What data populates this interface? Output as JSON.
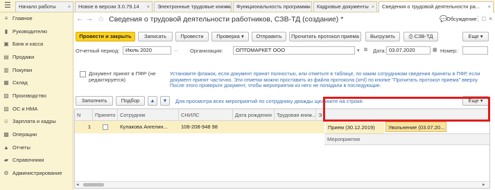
{
  "tabs": [
    {
      "label": "Начало работы"
    },
    {
      "label": "Новое в версии 3.0.79.14"
    },
    {
      "label": "Электронные трудовые книжки"
    },
    {
      "label": "Функциональность программы"
    },
    {
      "label": "Кадровые документы"
    },
    {
      "label": "Сведения о трудовой деятельности ра..."
    }
  ],
  "sidebar": {
    "items": [
      {
        "label": "Главное",
        "icon": "menu-icon"
      },
      {
        "label": "Руководителю",
        "icon": "chart-icon"
      },
      {
        "label": "Банк и касса",
        "icon": "bank-icon"
      },
      {
        "label": "Продажи",
        "icon": "cart-icon"
      },
      {
        "label": "Покупки",
        "icon": "basket-icon"
      },
      {
        "label": "Склад",
        "icon": "warehouse-icon"
      },
      {
        "label": "Производство",
        "icon": "factory-icon"
      },
      {
        "label": "ОС и НМА",
        "icon": "assets-icon"
      },
      {
        "label": "Зарплата и кадры",
        "icon": "people-icon"
      },
      {
        "label": "Операции",
        "icon": "operations-icon"
      },
      {
        "label": "Отчеты",
        "icon": "reports-icon"
      },
      {
        "label": "Справочники",
        "icon": "books-icon"
      },
      {
        "label": "Администрирование",
        "icon": "gear-icon"
      }
    ]
  },
  "header": {
    "title": "Сведения о трудовой деятельности работников, СЗВ-ТД (создание) *",
    "discuss": "Обсуждение"
  },
  "toolbar": {
    "post_close": "Провести и закрыть",
    "save": "Записать",
    "post": "Провести",
    "check": "Проверка",
    "send": "Отправить",
    "read_protocol": "Прочитать протокол приема",
    "upload": "Выгрузить",
    "print": "СЗВ-ТД",
    "more": "Еще"
  },
  "form": {
    "period_label": "Отчетный период:",
    "period_value": "Июль 2020",
    "org_label": "Организация:",
    "org_value": "ОПТОМАРКЕТ ООО",
    "date_label": "Дата:",
    "date_value": "03.07.2020",
    "number_label": "Номер:",
    "number_value": "",
    "accepted_label": "Документ принят в ПФР (не редактируется)",
    "note": "Установите флажок, если документ принят полностью, или отметьте в таблице, по каким сотрудникам сведения приняты в ПФР, если документ принят частично. Эти отметки можно проставить из файла протокола (xml) по кнопке \"Прочитать протокол приема\" вверху. После этого проверьте документ, чтобы мероприятия из него не попадали в последующие."
  },
  "table_toolbar": {
    "fill": "Заполнить",
    "select": "Подбор",
    "hint": "Для просмотра всех мероприятий по сотруднику дважды щелкните на строке.",
    "more": "Еще"
  },
  "table": {
    "columns": [
      "N",
      "Принято",
      "Сотрудник",
      "СНИЛС",
      "Дата рождения",
      "Трудовая книж...",
      "Э"
    ],
    "rows": [
      {
        "n": "1",
        "employee": "Кулакова Ангелин...",
        "snils": "108-208-948 98",
        "birth": "",
        "book": ""
      }
    ],
    "events_header": "Мероприятия",
    "events": [
      "Прием (30.12.2019)",
      "Увольнение (03.07.20..."
    ]
  },
  "colors": {
    "accent": "#ffd21f",
    "sidebar_bg": "#fbf4d3",
    "highlight": "#e01b1b",
    "link": "#3a6fb0"
  }
}
